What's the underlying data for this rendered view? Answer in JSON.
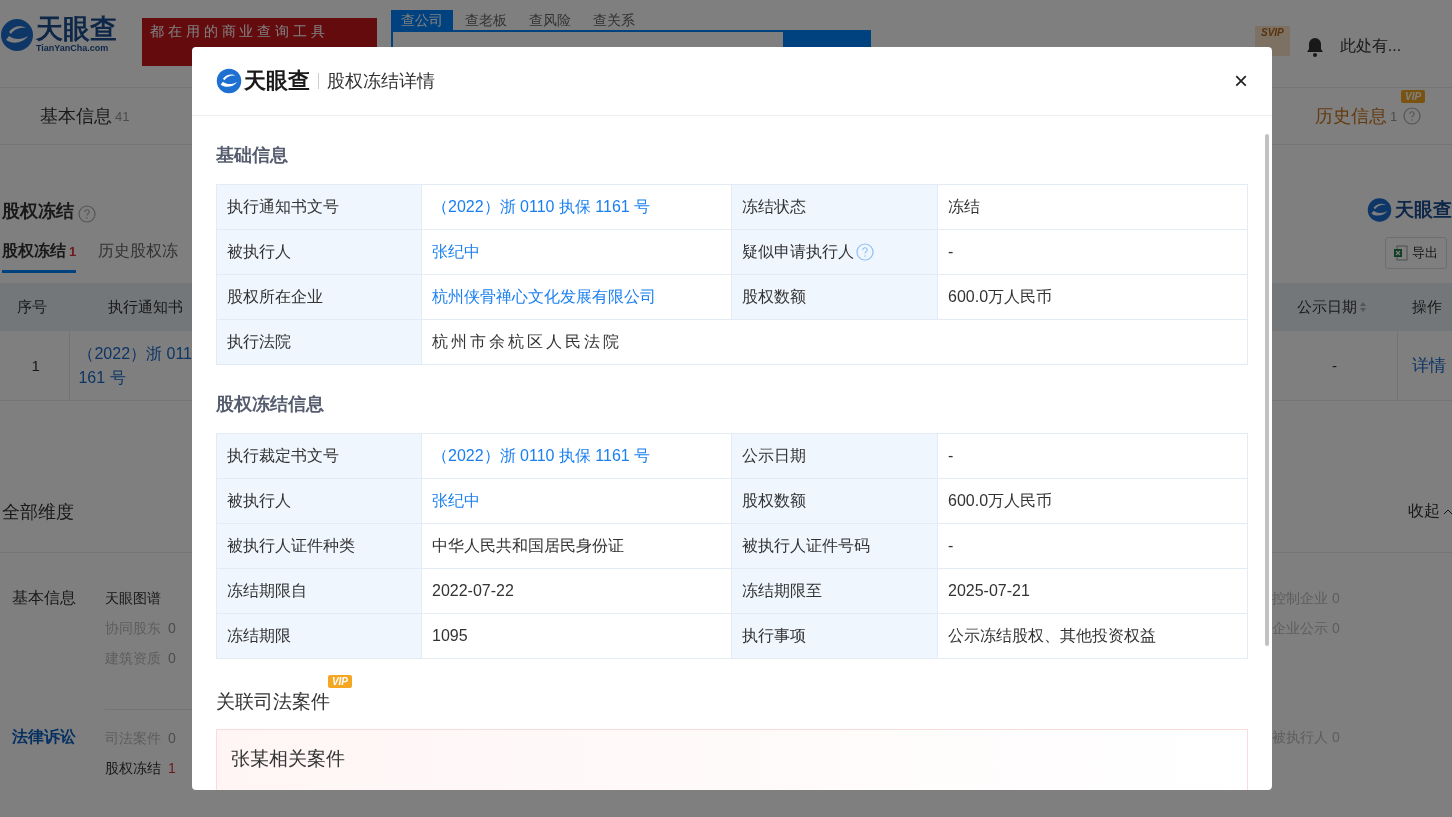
{
  "header": {
    "logo": {
      "name": "天眼查",
      "domain": "TianYanCha.com"
    },
    "banner": "都 在 用 的 商 业 查 询 工 具",
    "search_tabs": [
      {
        "label": "查公司",
        "selected": true
      },
      {
        "label": "查老板",
        "selected": false
      },
      {
        "label": "查风险",
        "selected": false
      },
      {
        "label": "查关系",
        "selected": false
      }
    ],
    "svip": {
      "badge": "SVIP"
    },
    "user": "此处有..."
  },
  "page_tabs": [
    {
      "label": "基本信息",
      "count": "41",
      "kind": "plain"
    },
    {
      "label": "历史信息",
      "count": "1",
      "kind": "vip",
      "badge": "VIP"
    }
  ],
  "section": {
    "title": "股权冻结",
    "tabs": [
      {
        "label": "股权冻结",
        "count": "1",
        "selected": true
      },
      {
        "label": "历史股权冻",
        "selected": false
      }
    ],
    "brand": "天眼查",
    "export": "导出"
  },
  "records": {
    "columns": [
      {
        "label": "序号"
      },
      {
        "label": "执行通知书"
      },
      {
        "label": "公示日期",
        "sortable": true
      },
      {
        "label": "操作"
      }
    ],
    "rows": [
      {
        "index": "1",
        "number_lines": [
          "（2022）浙 011",
          "161 号"
        ],
        "date": "-",
        "action": "详情"
      }
    ]
  },
  "dimensions": {
    "title": "全部维度",
    "toggle": "收起",
    "groups": [
      {
        "name": "基本信息",
        "selected": false,
        "items": [
          {
            "label": "天眼图谱",
            "disabled": false
          },
          {
            "label": "协同股东",
            "count": "0",
            "disabled": true
          },
          {
            "label": "建筑资质",
            "count": "0",
            "disabled": true
          }
        ],
        "more": [
          {
            "label": "控制企业",
            "count": "0",
            "disabled": true
          },
          {
            "label": "企业公示",
            "count": "0",
            "disabled": true
          }
        ]
      },
      {
        "name": "法律诉讼",
        "selected": true,
        "items": [
          {
            "label": "司法案件",
            "count": "0",
            "disabled": true
          },
          {
            "label": "股权冻结",
            "count": "1",
            "disabled": false
          }
        ],
        "more": [
          {
            "label": "被执行人",
            "count": "0",
            "disabled": true
          }
        ]
      }
    ]
  },
  "modal": {
    "brand": "天眼查",
    "title": "股权冻结详情",
    "close": "×",
    "sections": [
      {
        "title": "基础信息",
        "rows": [
          [
            {
              "label": "执行通知书文号",
              "value": "（2022）浙 0110 执保 1161 号",
              "link": true
            },
            {
              "label": "冻结状态",
              "value": "冻结",
              "link": false
            }
          ],
          [
            {
              "label": "被执行人",
              "value": "张纪中",
              "link": true
            },
            {
              "label": "疑似申请执行人",
              "help": true,
              "value": "-",
              "link": false
            }
          ],
          [
            {
              "label": "股权所在企业",
              "value": "杭州侠骨禅心文化发展有限公司",
              "link": true
            },
            {
              "label": "股权数额",
              "value": "600.0万人民币",
              "link": false
            }
          ],
          [
            {
              "label": "执行法院",
              "value": "杭州市余杭区人民法院",
              "link": false
            }
          ]
        ]
      },
      {
        "title": "股权冻结信息",
        "rows": [
          [
            {
              "label": "执行裁定书文号",
              "value": "（2022）浙 0110 执保 1161 号",
              "link": true
            },
            {
              "label": "公示日期",
              "value": "-",
              "link": false
            }
          ],
          [
            {
              "label": "被执行人",
              "value": "张纪中",
              "link": true
            },
            {
              "label": "股权数额",
              "value": "600.0万人民币",
              "link": false
            }
          ],
          [
            {
              "label": "被执行人证件种类",
              "value": "中华人民共和国居民身份证",
              "link": false
            },
            {
              "label": "被执行人证件号码",
              "value": "-",
              "link": false
            }
          ],
          [
            {
              "label": "冻结期限自",
              "value": "2022-07-22",
              "link": false
            },
            {
              "label": "冻结期限至",
              "value": "2025-07-21",
              "link": false
            }
          ],
          [
            {
              "label": "冻结期限",
              "value": "1095",
              "link": false
            },
            {
              "label": "执行事项",
              "value": "公示冻结股权、其他投资权益",
              "link": false
            }
          ]
        ]
      }
    ],
    "related": {
      "title": "关联司法案件",
      "badge": "VIP",
      "card_title": "张某相关案件"
    }
  }
}
